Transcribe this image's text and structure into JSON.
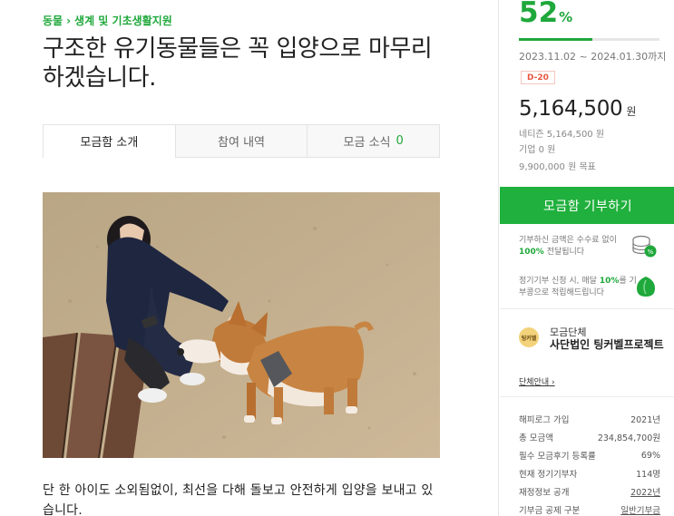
{
  "breadcrumb": {
    "category": "동물",
    "separator": "›",
    "subcategory": "생계 및 기초생활지원"
  },
  "title": "구조한 유기동물들은 꼭 입양으로 마무리하겠습니다.",
  "tabs": [
    {
      "label": "모금함 소개",
      "count": ""
    },
    {
      "label": "참여 내역",
      "count": ""
    },
    {
      "label": "모금 소식",
      "count": "0"
    }
  ],
  "photo": {
    "alt": "개를 쓰다듬는 사람"
  },
  "body_text": "단 한 아이도 소외됨없이, 최선을 다해 돌보고 안전하게 입양을 보내고 있습니다.",
  "sidebar": {
    "percent": "52",
    "percent_unit": "%",
    "progress": 0.52,
    "date_range": "2023.11.02 ~ 2024.01.30까지",
    "dday": "D-20",
    "amount": "5,164,500",
    "amount_unit": "원",
    "netizen": "네티즌 5,164,500 원",
    "company": "기업 0 원",
    "goal": "9,900,000 원 목표",
    "donate_button": "모금함 기부하기",
    "info1_pre": "기부하신 금액은 수수료 없이",
    "info1_bold": "100%",
    "info1_post": "전달됩니다",
    "info2_pre": "정기기부 신청 시, 매달",
    "info2_bold": "10%",
    "info2_post": "를 기부콩으로 적립해드립니다",
    "org_logo_text": "팅커벨",
    "org_label": "모금단체",
    "org_name": "사단법인 팅커벨프로젝트",
    "org_link": "단체안내",
    "stats": [
      {
        "label": "해피로그 가입",
        "value": "2021년",
        "link": false
      },
      {
        "label": "총 모금액",
        "value": "234,854,700원",
        "link": false
      },
      {
        "label": "필수 모금후기 등록률",
        "value": "69%",
        "link": false
      },
      {
        "label": "현재 정기기부자",
        "value": "114명",
        "link": false
      },
      {
        "label": "재정정보 공개",
        "value": "2022년",
        "link": true
      },
      {
        "label": "기부금 공제 구분",
        "value": "일반기부금",
        "link": true
      }
    ],
    "colors": {
      "accent": "#1fa83b",
      "dday": "#e8553f"
    }
  }
}
